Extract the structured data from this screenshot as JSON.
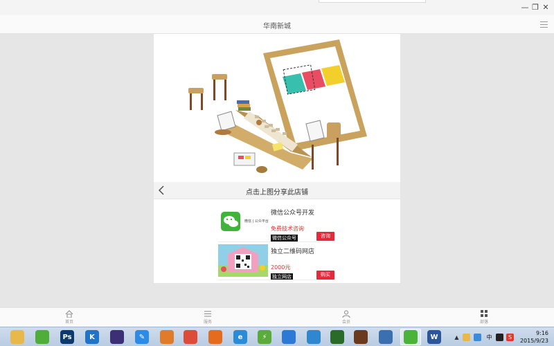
{
  "window": {
    "minimize_glyph": "—",
    "restore_glyph": "❐",
    "close_glyph": "✕"
  },
  "app": {
    "title": "华南新城"
  },
  "hero": {
    "alt_icon": "laptop-desk-illustration"
  },
  "share_bar": {
    "text": "点击上图分享此店铺"
  },
  "products": [
    {
      "name": "微信公众号开发",
      "price": "免费技术咨询",
      "tag": "微信公众号",
      "button": "咨询",
      "thumb_caption": "微信 | 公众平台",
      "icon": "wechat-logo"
    },
    {
      "name": "独立二维码网店",
      "price": "2000元",
      "tag": "独立网店",
      "button": "购买",
      "icon": "qr-shop-image"
    }
  ],
  "bottom_nav": [
    {
      "label": "首页",
      "icon": "home-icon"
    },
    {
      "label": "服务",
      "icon": "list-icon"
    },
    {
      "label": "会员",
      "icon": "user-icon"
    },
    {
      "label": "部落",
      "icon": "grid-icon"
    }
  ],
  "taskbar": {
    "apps": [
      {
        "name": "file-explorer",
        "glyph": "",
        "color": "#e8b84a"
      },
      {
        "name": "leaf-app",
        "glyph": "",
        "color": "#4fae3a"
      },
      {
        "name": "photoshop",
        "glyph": "Ps",
        "color": "#0b3b6e"
      },
      {
        "name": "k-app",
        "glyph": "K",
        "color": "#1f74c8"
      },
      {
        "name": "eclipse",
        "glyph": "",
        "color": "#3c2f76"
      },
      {
        "name": "edit-app",
        "glyph": "✎",
        "color": "#2b8be6"
      },
      {
        "name": "shield-app",
        "glyph": "",
        "color": "#e07b2b"
      },
      {
        "name": "chrome",
        "glyph": "",
        "color": "#dd4b39"
      },
      {
        "name": "firefox",
        "glyph": "",
        "color": "#e56b1f"
      },
      {
        "name": "ie",
        "glyph": "e",
        "color": "#2a8bd8"
      },
      {
        "name": "android-tool",
        "glyph": "⚡",
        "color": "#5aaa3c"
      },
      {
        "name": "baidu-cloud",
        "glyph": "",
        "color": "#2c7ad6"
      },
      {
        "name": "network-app",
        "glyph": "",
        "color": "#2f88cf"
      },
      {
        "name": "eye-app",
        "glyph": "",
        "color": "#2a6b2a"
      },
      {
        "name": "game-app",
        "glyph": "",
        "color": "#6b3a1e"
      },
      {
        "name": "remote-app",
        "glyph": "",
        "color": "#3a6fb0"
      },
      {
        "name": "wechat",
        "glyph": "",
        "color": "#4cb33a"
      },
      {
        "name": "word",
        "glyph": "W",
        "color": "#2b579a"
      }
    ],
    "clock_time": "9:16",
    "clock_date": "2015/9/23",
    "tray_ime": "中"
  }
}
